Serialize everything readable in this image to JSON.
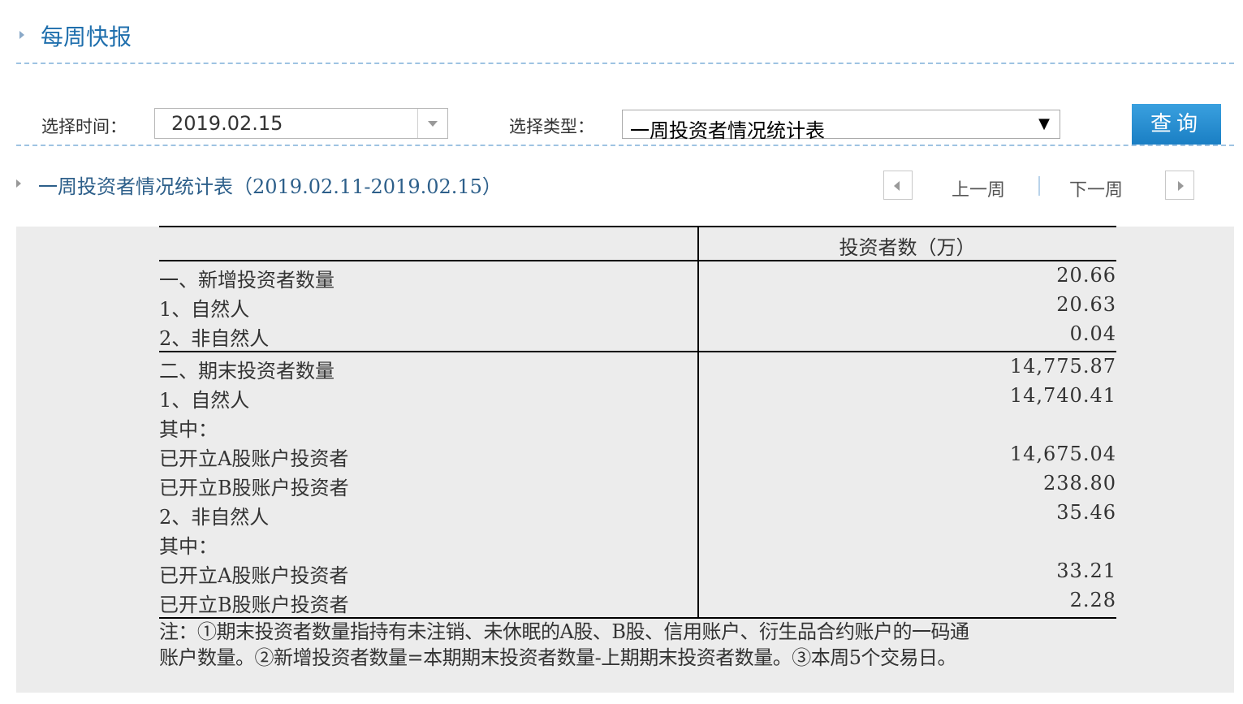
{
  "header": {
    "title": "每周快报"
  },
  "filters": {
    "time_label": "选择时间：",
    "time_value": "2019.02.15",
    "type_label": "选择类型：",
    "type_value": "一周投资者情况统计表",
    "query_label": "查询"
  },
  "report": {
    "title": "一周投资者情况统计表（2019.02.11-2019.02.15）",
    "prev_week": "上一周",
    "next_week": "下一周",
    "column_header": "投资者数（万）",
    "rows": [
      {
        "label": "一、新增投资者数量",
        "value": "20.66"
      },
      {
        "label": "1、自然人",
        "value": "20.63"
      },
      {
        "label": "2、非自然人",
        "value": "0.04"
      },
      {
        "label": "二、期末投资者数量",
        "value": "14,775.87"
      },
      {
        "label": "1、自然人",
        "value": "14,740.41"
      },
      {
        "label": "其中：",
        "value": ""
      },
      {
        "label": "已开立A股账户投资者",
        "value": "14,675.04"
      },
      {
        "label": "已开立B股账户投资者",
        "value": "238.80"
      },
      {
        "label": "2、非自然人",
        "value": "35.46"
      },
      {
        "label": "其中：",
        "value": ""
      },
      {
        "label": "已开立A股账户投资者",
        "value": "33.21"
      },
      {
        "label": "已开立B股账户投资者",
        "value": "2.28"
      }
    ],
    "note_line1": "注：①期末投资者数量指持有未注销、未休眠的A股、B股、信用账户、衍生品合约账户的一码通",
    "note_line2": "账户数量。②新增投资者数量=本期期末投资者数量-上期期末投资者数量。③本周5个交易日。"
  }
}
